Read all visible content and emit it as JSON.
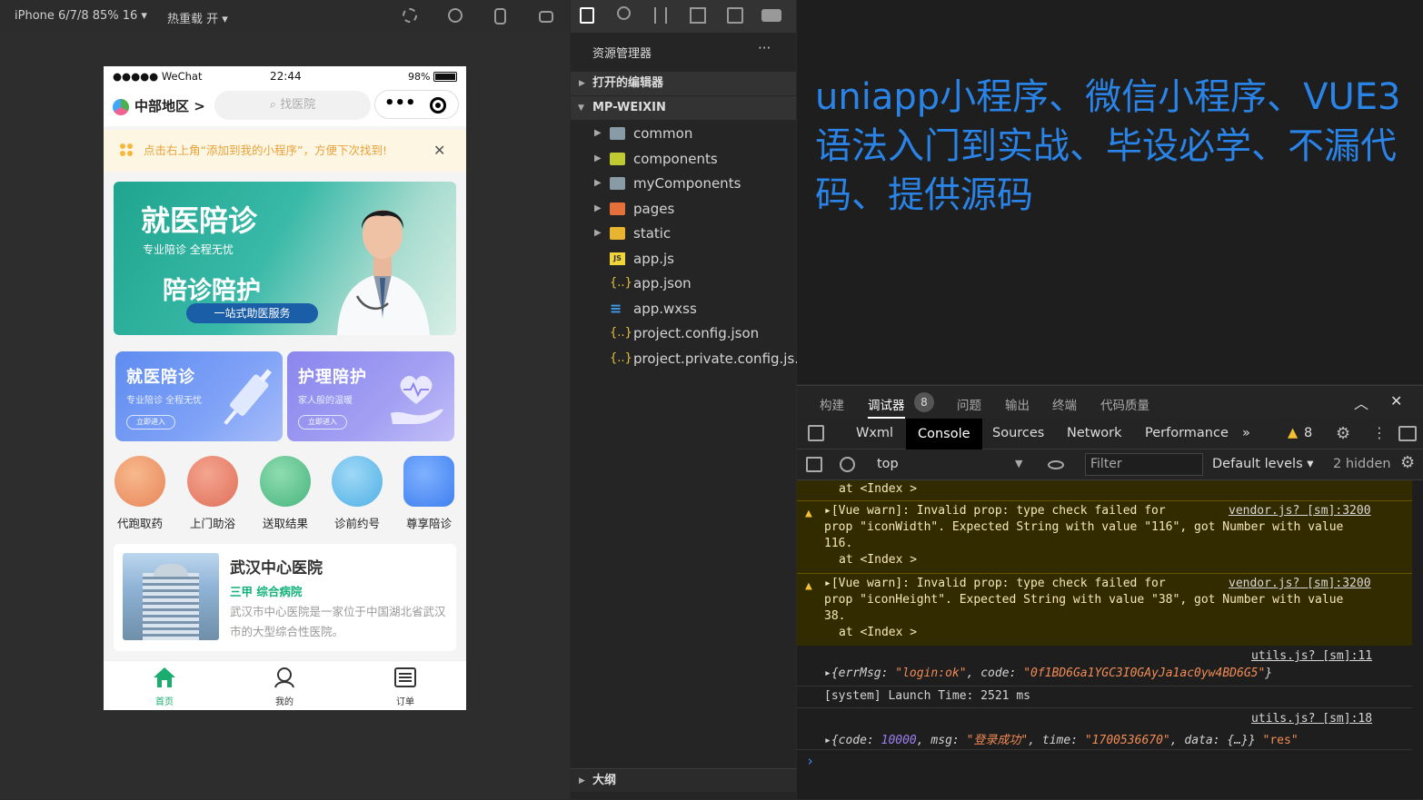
{
  "sim_toolbar": {
    "device": "iPhone 6/7/8 85% 16 ▾",
    "hot_reload": "热重载 开 ▾"
  },
  "phone": {
    "status": {
      "carrier": "●●●●● WeChat",
      "time": "22:44",
      "battery": "98%"
    },
    "nav": {
      "region": "中部地区 >",
      "search_placeholder": "找医院",
      "capsule_dots": "•••"
    },
    "tip": "点击右上角“添加到我的小程序”，方便下次找到!",
    "tip_close": "✕",
    "banner": {
      "title": "就医陪诊",
      "subtitle": "专业陪诊 全程无忧",
      "title2": "陪诊陪护",
      "badge": "一站式助医服务"
    },
    "cards": [
      {
        "title": "就医陪诊",
        "sub": "专业陪诊 全程无忧",
        "btn": "立即进入"
      },
      {
        "title": "护理陪护",
        "sub": "家人般的温暖",
        "btn": "立即进入"
      }
    ],
    "services": [
      "代跑取药",
      "上门助浴",
      "送取结果",
      "诊前约号",
      "尊享陪诊"
    ],
    "hospital": {
      "name": "武汉中心医院",
      "tags": "三甲  综合病院",
      "desc": "武汉市中心医院是一家位于中国湖北省武汉市的大型综合性医院。"
    },
    "tabs": [
      "首页",
      "我的",
      "订单"
    ]
  },
  "explorer": {
    "title": "资源管理器",
    "more": "···",
    "open_editors": "打开的编辑器",
    "project": "MP-WEIXIN",
    "outline": "大纲",
    "files": [
      {
        "name": "common",
        "type": "folder"
      },
      {
        "name": "components",
        "type": "folder"
      },
      {
        "name": "myComponents",
        "type": "folder"
      },
      {
        "name": "pages",
        "type": "folder"
      },
      {
        "name": "static",
        "type": "folder"
      },
      {
        "name": "app.js",
        "type": "js"
      },
      {
        "name": "app.json",
        "type": "json"
      },
      {
        "name": "app.wxss",
        "type": "css"
      },
      {
        "name": "project.config.json",
        "type": "json"
      },
      {
        "name": "project.private.config.js...",
        "type": "json"
      }
    ]
  },
  "headline": "uniapp小程序、微信小程序、VUE3语法入门到实战、毕设必学、不漏代码、提供源码",
  "devtools": {
    "top_tabs": [
      "构建",
      "调试器",
      "问题",
      "输出",
      "终端",
      "代码质量"
    ],
    "debugger_badge": "8",
    "panel_tabs": [
      "Wxml",
      "Console",
      "Sources",
      "Network",
      "Performance",
      "»"
    ],
    "warn_count": "8",
    "context": "top",
    "filter_placeholder": "Filter",
    "levels": "Default levels ▾",
    "hidden": "2 hidden",
    "console": {
      "line0": "at <Index >",
      "warn1": {
        "l1": "▸[Vue warn]: Invalid prop: type check failed for",
        "src": "vendor.js? [sm]:3200",
        "l2": "prop \"iconWidth\". Expected String with value \"116\", got Number with value",
        "l3": "116.",
        "l4": "at <Index >"
      },
      "warn2": {
        "l1": "▸[Vue warn]: Invalid prop: type check failed for",
        "src": "vendor.js? [sm]:3200",
        "l2": "prop \"iconHeight\". Expected String with value \"38\", got Number with value",
        "l3": "38.",
        "l4": "at <Index >"
      },
      "log1": {
        "src": "utils.js? [sm]:11",
        "k1": "errMsg",
        "v1": "\"login:ok\"",
        "k2": "code",
        "v2": "\"0f1BD6Ga1YGC3I0GAyJa1ac0yw4BD6G5\""
      },
      "log2": "[system] Launch Time: 2521 ms",
      "log3": {
        "src": "utils.js? [sm]:18",
        "k1": "code",
        "v1": "10000",
        "k2": "msg",
        "v2": "\"登录成功\"",
        "k3": "time",
        "v3": "\"1700536670\"",
        "k4": "data",
        "v4": "{…}",
        "tail": "\"res\""
      },
      "prompt": "›"
    }
  }
}
